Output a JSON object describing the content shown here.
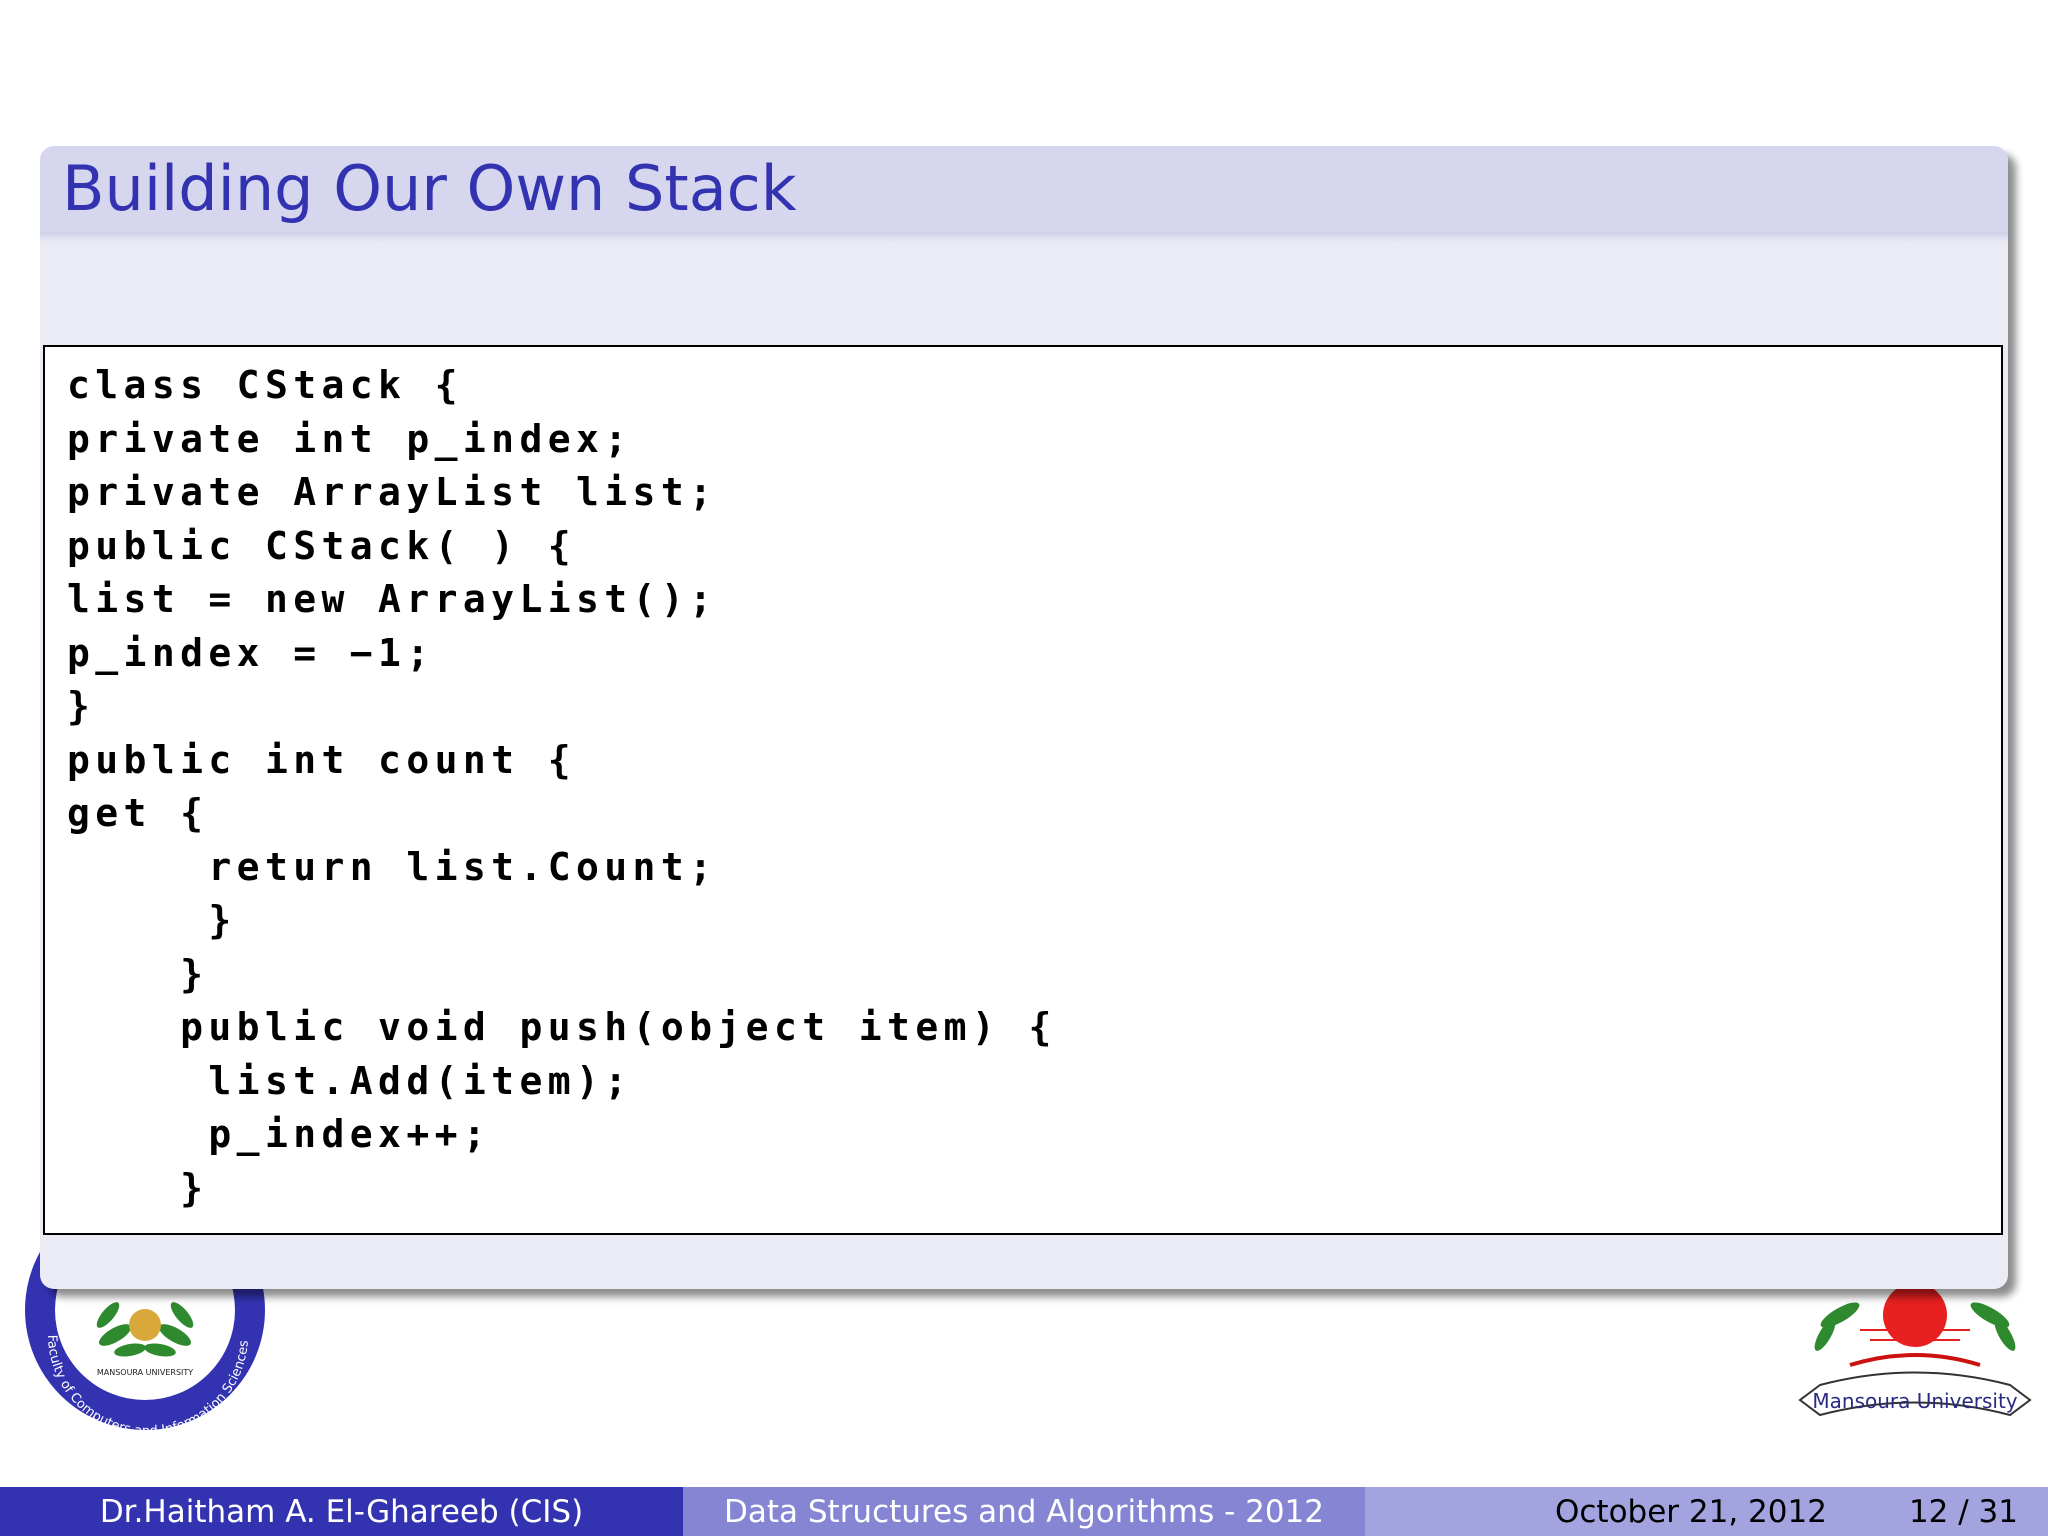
{
  "slide": {
    "title": "Building Our Own Stack"
  },
  "code": {
    "lines": [
      "class CStack {",
      "private int p_index;",
      "private ArrayList list;",
      "public CStack( ) {",
      "list = new ArrayList();",
      "p_index = −1;",
      "}",
      "public int count {",
      "get {",
      "     return list.Count;",
      "     }",
      "    }",
      "    public void push(object item) {",
      "     list.Add(item);",
      "     p_index++;",
      "    }"
    ]
  },
  "footer": {
    "author": "Dr.Haitham A. El-Ghareeb  (CIS)",
    "course": "Data Structures and Algorithms - 2012",
    "date": "October 21, 2012",
    "page": "12 / 31"
  },
  "logos": {
    "left_ring_text": "Faculty of Computers and Information Sciences",
    "left_seal_text": "MANSOURA UNIVERSITY",
    "right_text": "Mansoura University"
  },
  "colors": {
    "title": "#3333b2",
    "header_bg": "#d6d7ef",
    "block_bg": "#ebebf6",
    "footer_left": "#3333b2",
    "footer_center": "#8585d4",
    "footer_right": "#a3a3e0"
  }
}
